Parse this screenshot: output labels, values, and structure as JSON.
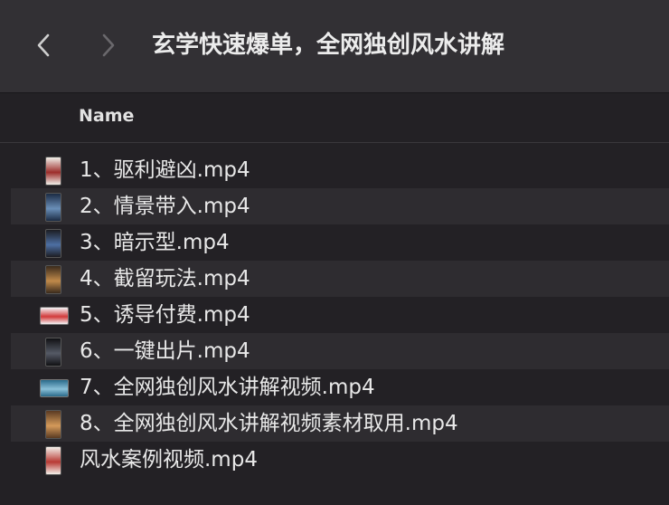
{
  "window": {
    "title": "玄学快速爆单，全网独创风水讲解"
  },
  "header": {
    "name_col": "Name"
  },
  "files": [
    {
      "name": "1、驱利避凶.mp4",
      "thumb": "portrait",
      "c1": "#f1efe9",
      "c2": "#9c2d2a"
    },
    {
      "name": "2、情景带入.mp4",
      "thumb": "portrait",
      "c1": "#1b2b44",
      "c2": "#6a8fb8"
    },
    {
      "name": "3、暗示型.mp4",
      "thumb": "portrait",
      "c1": "#1c1c22",
      "c2": "#4d6fa3"
    },
    {
      "name": "4、截留玩法.mp4",
      "thumb": "portrait",
      "c1": "#3a2a1c",
      "c2": "#c08a4a"
    },
    {
      "name": "5、诱导付费.mp4",
      "thumb": "wide",
      "c1": "#f4f4f6",
      "c2": "#d23a3a"
    },
    {
      "name": "6、一键出片.mp4",
      "thumb": "portrait",
      "c1": "#111114",
      "c2": "#555a66"
    },
    {
      "name": "7、全网独创风水讲解视频.mp4",
      "thumb": "wide",
      "c1": "#2a6a8a",
      "c2": "#8ac0d8"
    },
    {
      "name": "8、全网独创风水讲解视频素材取用.mp4",
      "thumb": "portrait",
      "c1": "#5a3a22",
      "c2": "#d49a5a"
    },
    {
      "name": "风水案例视频.mp4",
      "thumb": "portrait",
      "c1": "#f3f0ea",
      "c2": "#b83a34"
    }
  ]
}
